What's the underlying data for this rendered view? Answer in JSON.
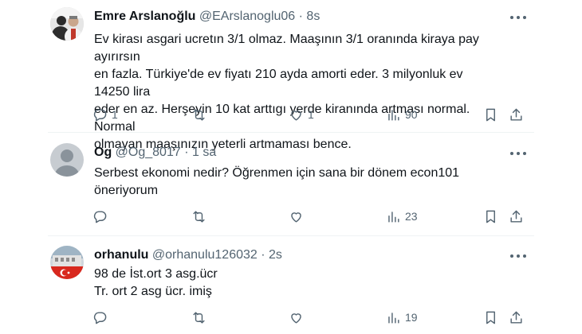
{
  "tweets": [
    {
      "name": "Emre Arslanoğlu",
      "handle": "@EArslanoglu06",
      "time": "· 8s",
      "lines": [
        "Ev kirası asgari ucretın 3/1 olmaz. Maaşının 3/1 oranında kiraya pay ayırırsın",
        "en fazla. Türkiye'de ev fiyatı 210 ayda amorti eder. 3 milyonluk ev 14250 lira",
        "eder en az. Herşeyin 10 kat arttıgı yerde kiranında artması normal. Normal",
        "olmayan maaşınızın yeterli artmaması bence."
      ],
      "replies": "1",
      "retweets": "",
      "likes": "1",
      "views": "90"
    },
    {
      "name": "Og",
      "handle": "@Og_8017",
      "time": "· 1 sa",
      "lines": [
        "Serbest ekonomi nedir? Öğrenmen için sana bir dönem econ101",
        "öneriyorum"
      ],
      "replies": "",
      "retweets": "",
      "likes": "",
      "views": "23"
    },
    {
      "name": "orhanulu",
      "handle": "@orhanulu126032",
      "time": "· 2s",
      "lines": [
        "98 de İst.ort 3 asg.ücr",
        "Tr. ort 2 asg ücr. imiş"
      ],
      "replies": "",
      "retweets": "",
      "likes": "",
      "views": "19"
    }
  ],
  "icons": {
    "reply": "reply-icon",
    "retweet": "retweet-icon",
    "like": "heart-icon",
    "views": "views-icon",
    "bookmark": "bookmark-icon",
    "share": "share-icon",
    "more": "more-icon"
  },
  "colors": {
    "text": "#0f1419",
    "secondary": "#536471",
    "divider": "#eff3f4",
    "default_avatar_bg": "#c7ccd1"
  }
}
